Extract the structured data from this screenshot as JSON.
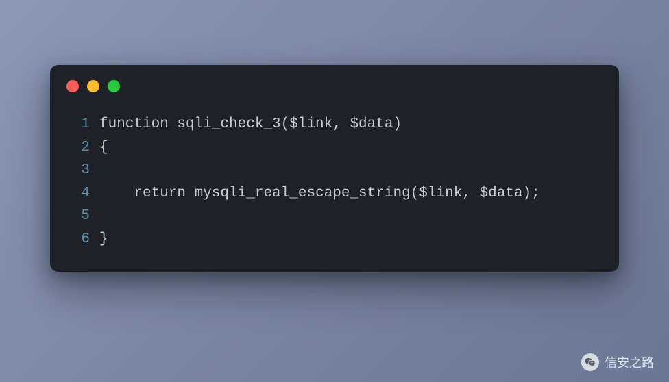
{
  "traffic_lights": {
    "red": "close-icon",
    "yellow": "minimize-icon",
    "green": "maximize-icon"
  },
  "code": {
    "lines": [
      {
        "num": "1",
        "text": "function sqli_check_3($link, $data)"
      },
      {
        "num": "2",
        "text": "{"
      },
      {
        "num": "3",
        "text": ""
      },
      {
        "num": "4",
        "text": "    return mysqli_real_escape_string($link, $data);"
      },
      {
        "num": "5",
        "text": ""
      },
      {
        "num": "6",
        "text": "}"
      }
    ]
  },
  "watermark": {
    "text": "信安之路"
  }
}
